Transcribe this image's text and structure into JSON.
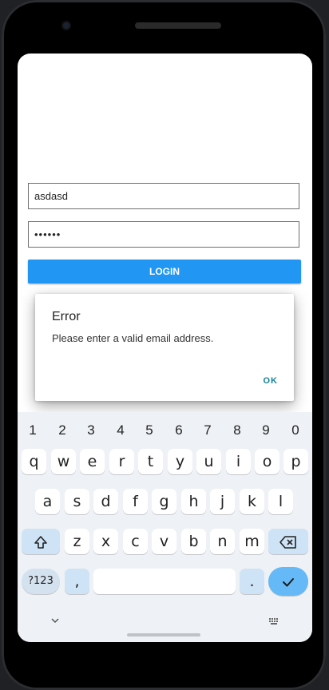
{
  "form": {
    "email_value": "asdasd",
    "password_value": "••••••",
    "login_label": "LOGIN"
  },
  "dialog": {
    "title": "Error",
    "message": "Please enter a valid email address.",
    "ok_label": "OK"
  },
  "keyboard": {
    "number_row": [
      "1",
      "2",
      "3",
      "4",
      "5",
      "6",
      "7",
      "8",
      "9",
      "0"
    ],
    "row1": [
      "q",
      "w",
      "e",
      "r",
      "t",
      "y",
      "u",
      "i",
      "o",
      "p"
    ],
    "row2": [
      "a",
      "s",
      "d",
      "f",
      "g",
      "h",
      "j",
      "k",
      "l"
    ],
    "row3": [
      "z",
      "x",
      "c",
      "v",
      "b",
      "n",
      "m"
    ],
    "symbols_label": "?123",
    "comma_label": ",",
    "period_label": ".",
    "shift_icon": "shift-icon",
    "backspace_icon": "backspace-icon",
    "enter_icon": "checkmark-icon",
    "hide_icon": "chevron-down-icon",
    "switch_icon": "keyboard-icon"
  }
}
